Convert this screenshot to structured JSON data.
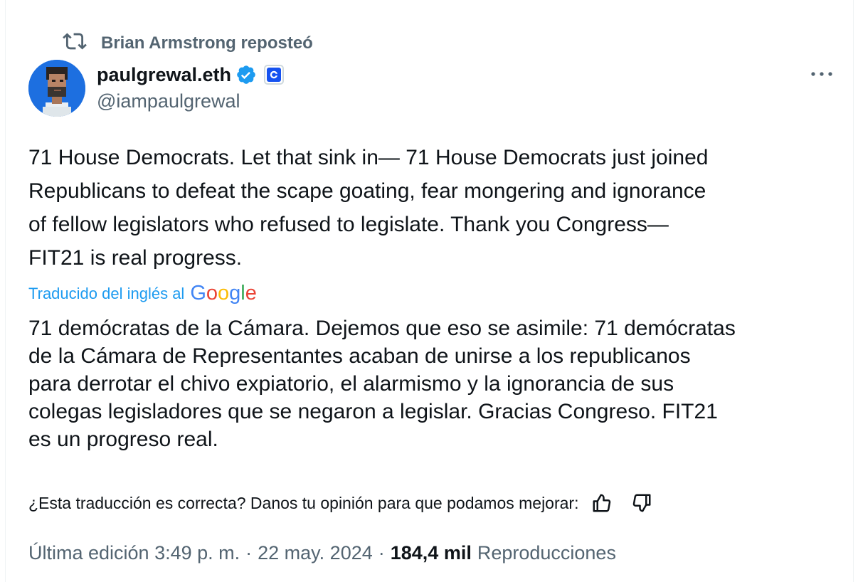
{
  "repost": {
    "text": "Brian Armstrong reposteó",
    "icon": "repost-icon"
  },
  "author": {
    "name": "paulgrewal.eth",
    "handle": "@iampaulgrewal",
    "verified_color": "#1d9bf0",
    "affiliate_icon": "coinbase-icon"
  },
  "tweet": {
    "text": "71 House Democrats. Let that sink in— 71 House Democrats just joined\nRepublicans to defeat the scape goating, fear mongering and ignorance\nof fellow legislators who refused to legislate. Thank you Congress—\nFIT21 is real progress."
  },
  "translation": {
    "label": "Traducido del inglés al",
    "provider": "Google",
    "text": "71 demócratas de la Cámara. Dejemos que eso se asimile: 71 demócratas\nde la Cámara de Representantes acaban de unirse a los republicanos\npara derrotar el chivo expiatorio, el alarmismo y la ignorancia de sus\ncolegas legisladores que se negaron a legislar. Gracias Congreso. FIT21\nes un progreso real.",
    "feedback_prompt": "¿Esta traducción es correcta? Danos tu opinión para que podamos mejorar:"
  },
  "meta": {
    "edited_time": "Última edición 3:49 p. m.",
    "separator": "·",
    "date": "22 may. 2024",
    "views_count": "184,4 mil",
    "views_label": "Reproducciones"
  },
  "colors": {
    "accent": "#1d9bf0",
    "secondary_text": "#536471",
    "text": "#0f1419"
  }
}
